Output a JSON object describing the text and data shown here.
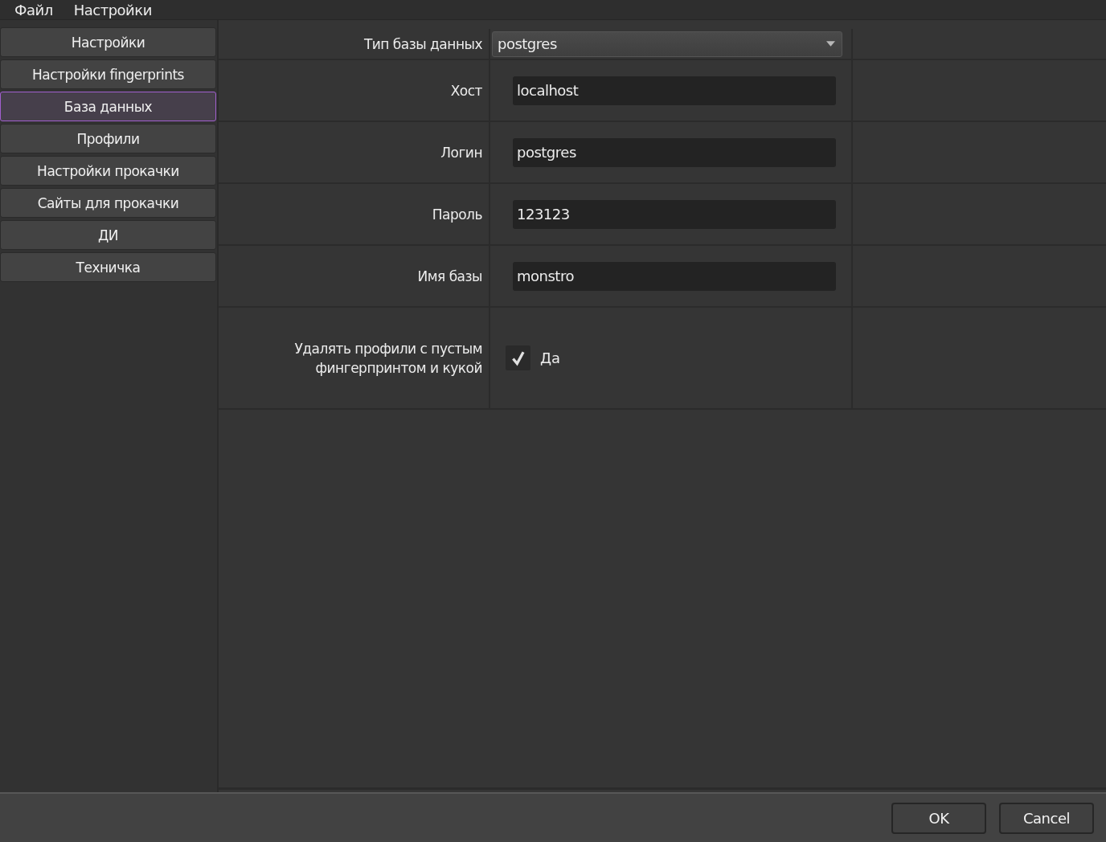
{
  "menu": [
    "Файл",
    "Настройки"
  ],
  "sidebar": {
    "items": [
      {
        "label": "Настройки",
        "selected": false
      },
      {
        "label": "Настройки fingerprints",
        "selected": false
      },
      {
        "label": "База данных",
        "selected": true
      },
      {
        "label": "Профили",
        "selected": false
      },
      {
        "label": "Настройки прокачки",
        "selected": false
      },
      {
        "label": "Сайты для прокачки",
        "selected": false
      },
      {
        "label": "ДИ",
        "selected": false
      },
      {
        "label": "Техничка",
        "selected": false
      }
    ]
  },
  "form": {
    "rows": [
      {
        "kind": "select",
        "label": "Тип базы данных",
        "value": "postgres"
      },
      {
        "kind": "text",
        "label": "Хост",
        "value": "localhost"
      },
      {
        "kind": "text",
        "label": "Логин",
        "value": "postgres"
      },
      {
        "kind": "text",
        "label": "Пароль",
        "value": "123123"
      },
      {
        "kind": "text",
        "label": "Имя базы",
        "value": "monstro"
      },
      {
        "kind": "checkbox",
        "label": "Удалять профили с пустым фингерпринтом и кукой",
        "text": "Да",
        "checked": true
      }
    ]
  },
  "buttons": [
    "OK",
    "Cancel"
  ]
}
